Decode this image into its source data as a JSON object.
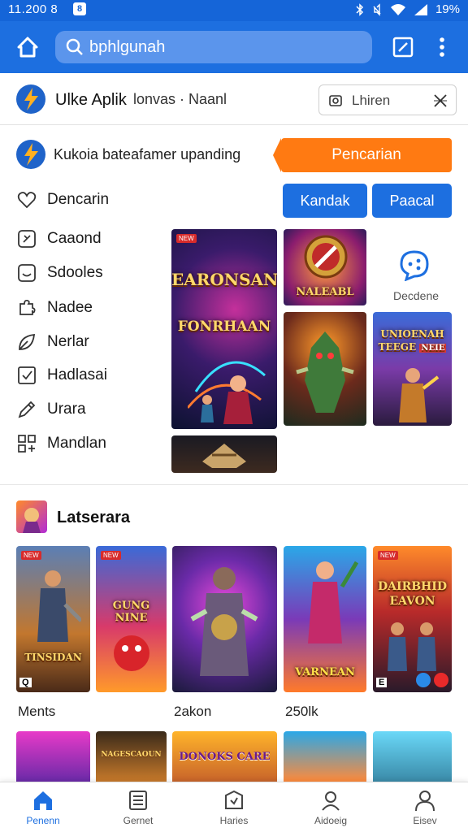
{
  "status_bar": {
    "time": "11.200 8",
    "box_glyph": "8",
    "battery": "19%"
  },
  "app_bar": {
    "search_placeholder": "bphlgunah"
  },
  "header": {
    "app_name": "Ulke Aplik",
    "meta": "lonvas · Naanl",
    "tag_label": "Lhiren"
  },
  "banner": {
    "text": "Kukoia bateafamer upanding",
    "cta": "Pencarian"
  },
  "menu": {
    "items": [
      {
        "label": "Dencarin",
        "icon": "heart-icon"
      },
      {
        "label": "Caaond",
        "icon": "sparkle-icon"
      },
      {
        "label": "Sdooles",
        "icon": "smile-icon"
      },
      {
        "label": "Nadee",
        "icon": "puzzle-icon"
      },
      {
        "label": "Nerlar",
        "icon": "leaf-icon"
      },
      {
        "label": "Hadlasai",
        "icon": "check-box-icon"
      },
      {
        "label": "Urara",
        "icon": "pencil-icon"
      },
      {
        "label": "Mandlan",
        "icon": "grid-icon"
      }
    ]
  },
  "actions": {
    "primary": "Kandak",
    "secondary": "Paacal"
  },
  "featured": {
    "main_title_1": "EARONSAN",
    "main_title_2": "FONRHAAN",
    "tile_a_title": "NALEABL",
    "tile_c_title_1": "UNIOENAH",
    "tile_c_title_2": "TEEGE",
    "tile_c_badge": "NEIE",
    "side_label": "Decdene"
  },
  "section": {
    "title": "Latserara",
    "cards": [
      {
        "title": "TINSIDAN",
        "badge": "Q"
      },
      {
        "title_1": "GUNG NINE",
        "title_2": ""
      },
      {
        "title": ""
      },
      {
        "title": "VARNEAN"
      },
      {
        "title_1": "DAIRBHID",
        "title_2": "EAVON",
        "badge": "E"
      }
    ],
    "labels": [
      "Ments",
      "2akon",
      "250lk"
    ],
    "row2_titles": [
      "",
      "NAGESCAOUN",
      "DONOKS CARE",
      "",
      ""
    ]
  },
  "bottom_nav": {
    "items": [
      {
        "label": "Penenn",
        "icon": "home-icon"
      },
      {
        "label": "Gernet",
        "icon": "list-icon"
      },
      {
        "label": "Haries",
        "icon": "shield-icon"
      },
      {
        "label": "Aidoeig",
        "icon": "user-search-icon"
      },
      {
        "label": "Eisev",
        "icon": "profile-icon"
      }
    ]
  },
  "colors": {
    "primary": "#1d6fe0",
    "accent": "#ff7a12"
  }
}
